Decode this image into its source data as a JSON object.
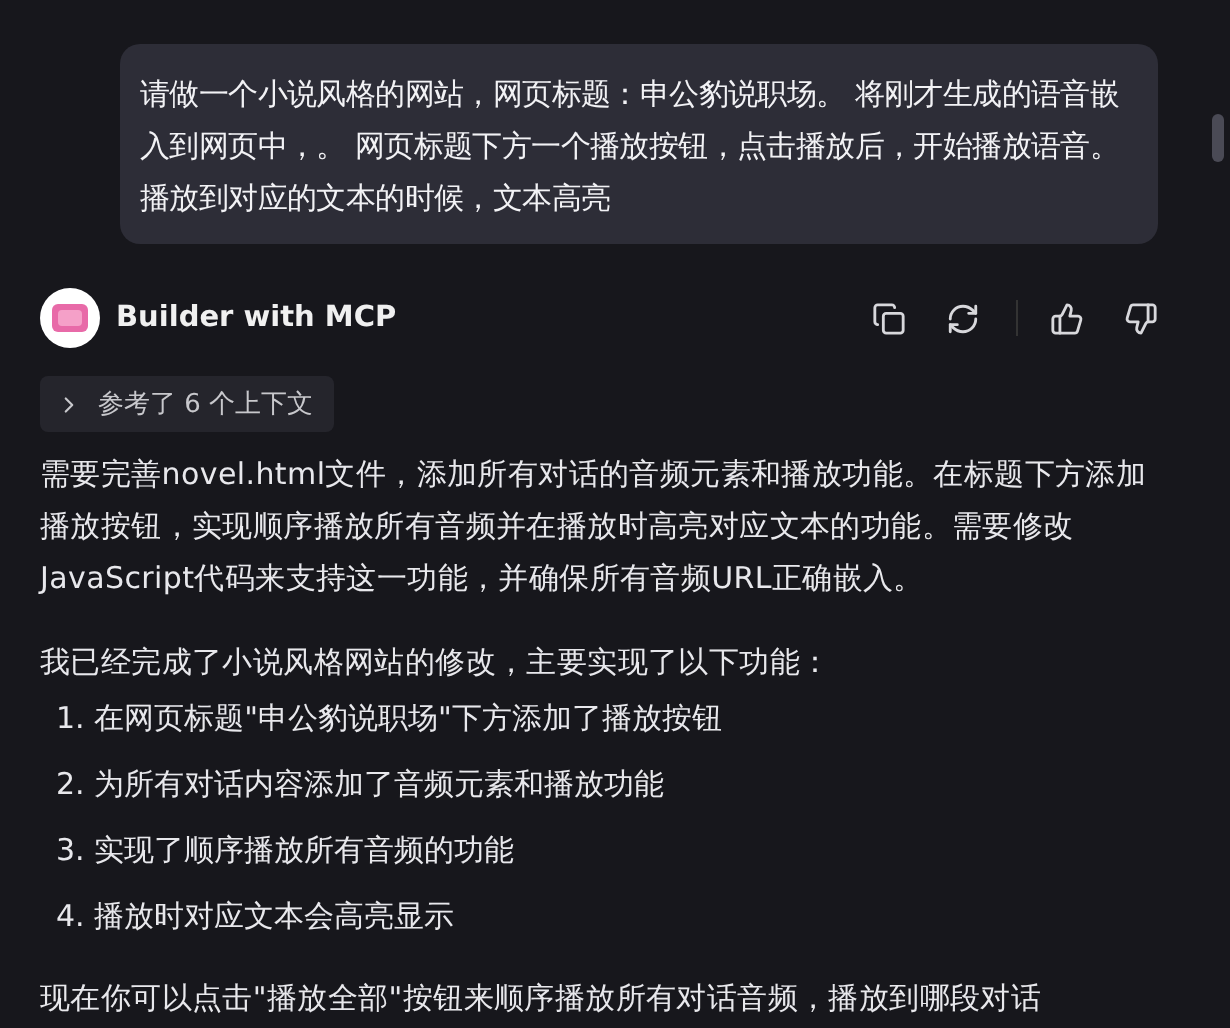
{
  "user_message": {
    "text": "请做一个小说风格的网站，网页标题：申公豹说职场。 将刚才生成的语音嵌入到网页中，。 网页标题下方一个播放按钮，点击播放后，开始播放语音。播放到对应的文本的时候，文本高亮"
  },
  "assistant": {
    "name": "Builder with MCP",
    "context_chip": {
      "label": "参考了 6 个上下文",
      "expanded": false
    },
    "paragraphs": [
      "需要完善novel.html文件，添加所有对话的音频元素和播放功能。在标题下方添加播放按钮，实现顺序播放所有音频并在播放时高亮对应文本的功能。需要修改JavaScript代码来支持这一功能，并确保所有音频URL正确嵌入。",
      "我已经完成了小说风格网站的修改，主要实现了以下功能："
    ],
    "list_items": [
      "1. 在网页标题\"申公豹说职场\"下方添加了播放按钮",
      "2. 为所有对话内容添加了音频元素和播放功能",
      "3. 实现了顺序播放所有音频的功能",
      "4. 播放时对应文本会高亮显示"
    ],
    "closing": "现在你可以点击\"播放全部\"按钮来顺序播放所有对话音频，播放到哪段对话"
  }
}
